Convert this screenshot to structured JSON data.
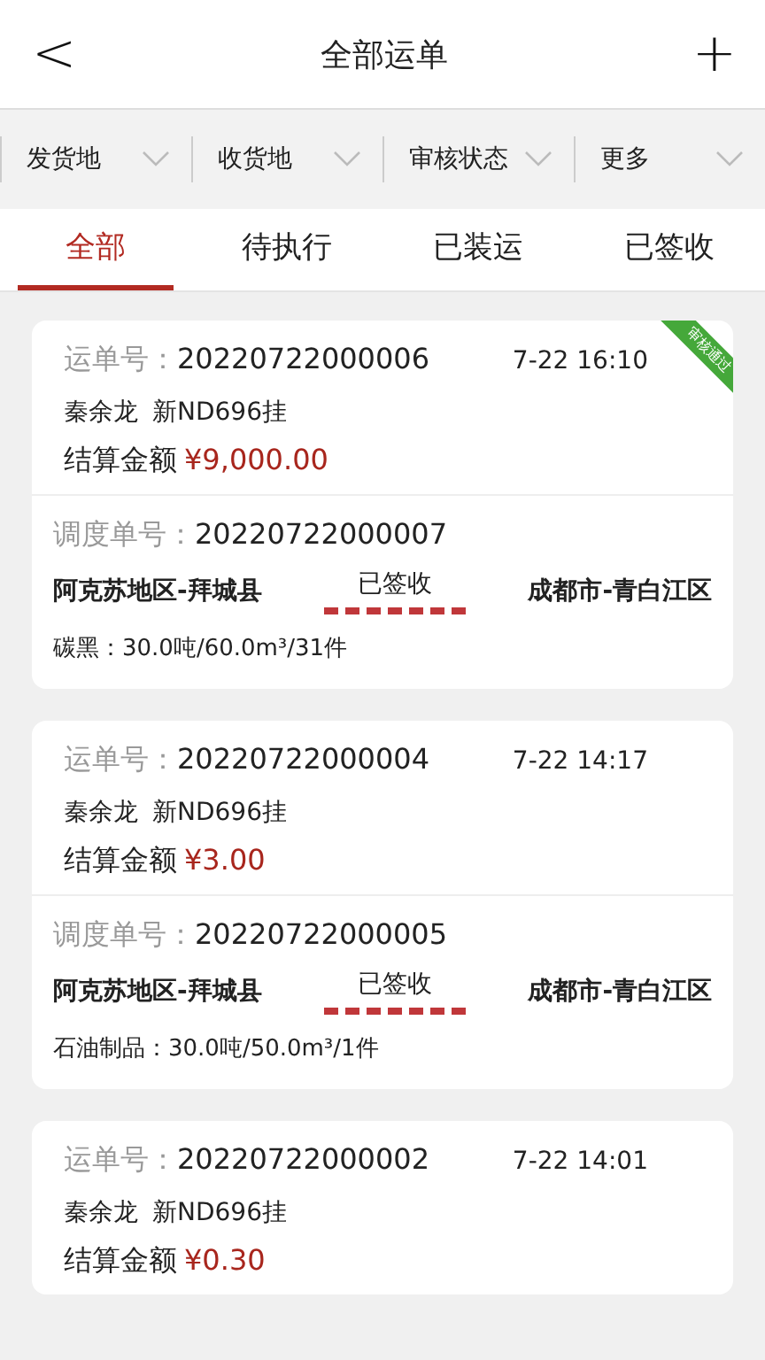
{
  "header": {
    "back": "<",
    "title": "全部运单",
    "add": "+"
  },
  "filters": [
    {
      "label": "发货地"
    },
    {
      "label": "收货地"
    },
    {
      "label": "审核状态"
    },
    {
      "label": "更多"
    }
  ],
  "tabs": [
    {
      "label": "全部",
      "selected": true
    },
    {
      "label": "待执行",
      "selected": false
    },
    {
      "label": "已装运",
      "selected": false
    },
    {
      "label": "已签收",
      "selected": false
    }
  ],
  "waybills": [
    {
      "number_label": "运单号：",
      "number": "20220722000006",
      "time": "7-22 16:10",
      "badge": "审核通过",
      "driver": "秦余龙",
      "plate": "新ND696挂",
      "amount_label": "结算金额",
      "amount": "¥9,000.00",
      "dispatch": {
        "label": "调度单号：",
        "number": "20220722000007",
        "origin": "阿克苏地区-拜城县",
        "status": "已签收",
        "destination": "成都市-青白江区",
        "cargo": "碳黑：30.0吨/60.0m³/31件"
      }
    },
    {
      "number_label": "运单号：",
      "number": "20220722000004",
      "time": "7-22 14:17",
      "driver": "秦余龙",
      "plate": "新ND696挂",
      "amount_label": "结算金额",
      "amount": "¥3.00",
      "dispatch": {
        "label": "调度单号：",
        "number": "20220722000005",
        "origin": "阿克苏地区-拜城县",
        "status": "已签收",
        "destination": "成都市-青白江区",
        "cargo": "石油制品：30.0吨/50.0m³/1件"
      }
    },
    {
      "number_label": "运单号：",
      "number": "20220722000002",
      "time": "7-22 14:01",
      "driver": "秦余龙",
      "plate": "新ND696挂",
      "amount_label": "结算金额",
      "amount": "¥0.30"
    }
  ]
}
